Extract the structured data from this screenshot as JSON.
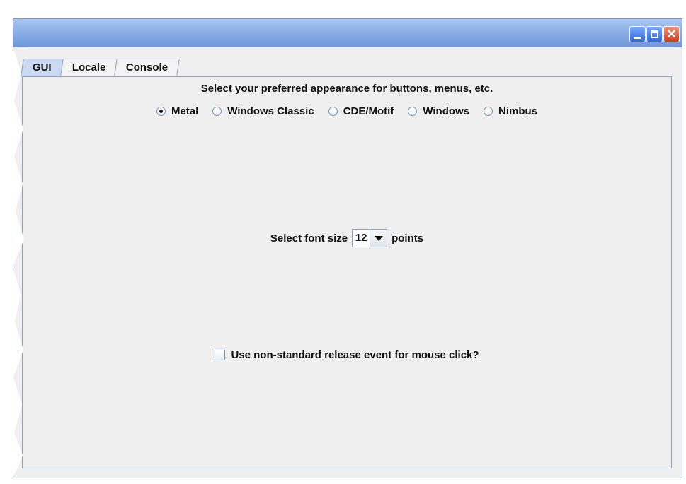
{
  "window": {
    "controls": {
      "minimize_icon": "minimize-icon",
      "maximize_icon": "maximize-icon",
      "close_icon": "close-icon"
    }
  },
  "tabs": [
    {
      "label": "GUI",
      "selected": true
    },
    {
      "label": "Locale",
      "selected": false
    },
    {
      "label": "Console",
      "selected": false
    }
  ],
  "gui_panel": {
    "appearance_heading": "Select your preferred appearance for buttons, menus, etc.",
    "appearance_options": [
      {
        "label": "Metal",
        "checked": true
      },
      {
        "label": "Windows Classic",
        "checked": false
      },
      {
        "label": "CDE/Motif",
        "checked": false
      },
      {
        "label": "Windows",
        "checked": false
      },
      {
        "label": "Nimbus",
        "checked": false
      }
    ],
    "font_size": {
      "label": "Select font size",
      "value": "12",
      "suffix": "points"
    },
    "mouse_release": {
      "label": "Use non-standard release event for mouse click?",
      "checked": false
    }
  },
  "colors": {
    "titlebar": "#89aee6",
    "tab_active": "#c9daf2",
    "border": "#8ea1bd"
  }
}
